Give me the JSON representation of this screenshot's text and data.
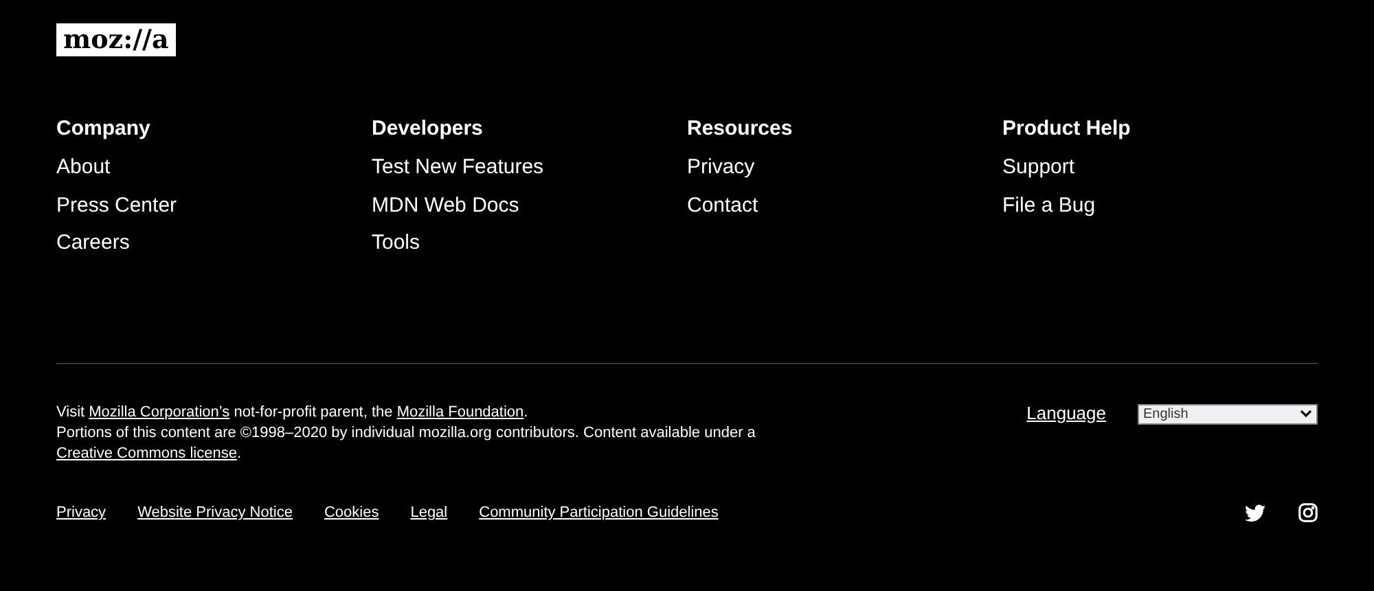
{
  "logo": {
    "text": "moz://a"
  },
  "columns": [
    {
      "heading": "Company",
      "links": [
        "About",
        "Press Center",
        "Careers"
      ]
    },
    {
      "heading": "Developers",
      "links": [
        "Test New Features",
        "MDN Web Docs",
        "Tools"
      ]
    },
    {
      "heading": "Resources",
      "links": [
        "Privacy",
        "Contact"
      ]
    },
    {
      "heading": "Product Help",
      "links": [
        "Support",
        "File a Bug"
      ]
    }
  ],
  "notice": [
    [
      {
        "kind": "text",
        "text": "Visit "
      },
      {
        "kind": "link",
        "text": "Mozilla Corporation’s"
      },
      {
        "kind": "text",
        "text": " not-for-profit parent, the "
      },
      {
        "kind": "link",
        "text": "Mozilla Foundation"
      },
      {
        "kind": "text",
        "text": "."
      }
    ],
    [
      {
        "kind": "text",
        "text": "Portions of this content are ©1998–2020 by individual mozilla.org contributors. Content available under a "
      },
      {
        "kind": "link",
        "text": "Creative Commons license"
      },
      {
        "kind": "text",
        "text": "."
      }
    ]
  ],
  "language": {
    "label": "Language",
    "value": "English"
  },
  "legal_links": [
    "Privacy",
    "Website Privacy Notice",
    "Cookies",
    "Legal",
    "Community Participation Guidelines"
  ],
  "social": [
    {
      "kind": "twitter"
    },
    {
      "kind": "instagram"
    }
  ]
}
